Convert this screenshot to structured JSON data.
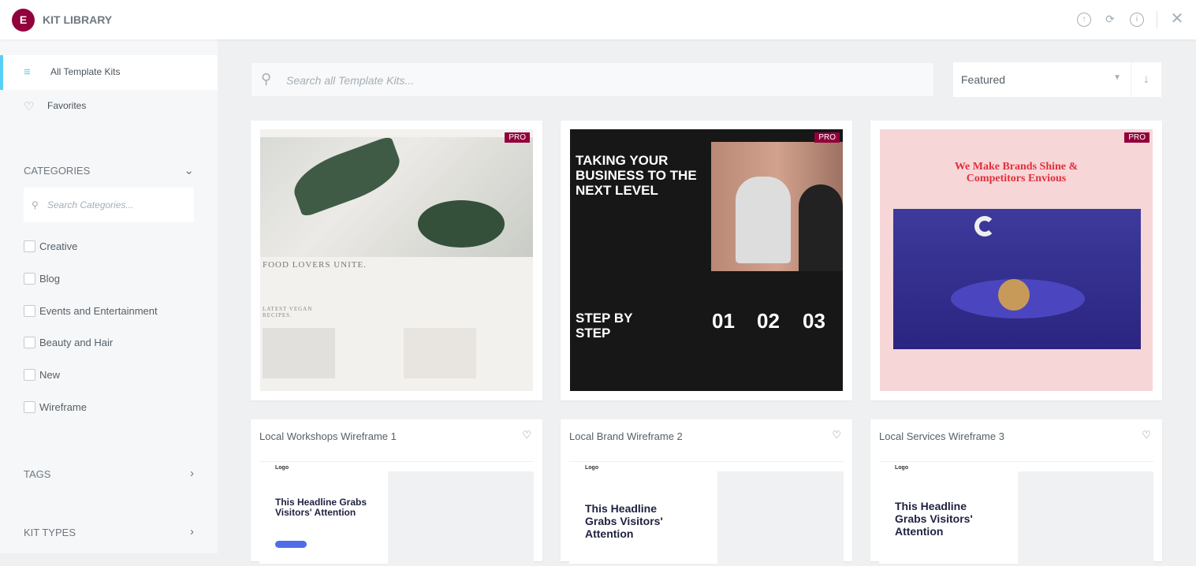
{
  "header": {
    "logo_letter": "E",
    "title": "KIT LIBRARY",
    "icons": [
      "upload-icon",
      "sync-icon",
      "info-icon",
      "close-icon"
    ]
  },
  "sidebar": {
    "nav": [
      {
        "label": "All Template Kits",
        "icon": "filter-icon",
        "active": true
      },
      {
        "label": "Favorites",
        "icon": "heart-icon"
      }
    ],
    "categories_label": "CATEGORIES",
    "categories_search_placeholder": "Search Categories...",
    "categories": [
      "Creative",
      "Blog",
      "Events and Entertainment",
      "Beauty and Hair",
      "New",
      "Wireframe"
    ],
    "tags_label": "TAGS",
    "kit_types_label": "KIT TYPES"
  },
  "main": {
    "search_placeholder": "Search all Template Kits...",
    "sort_value": "Featured",
    "pro_badge": "PRO",
    "kits": [
      {
        "thumb": {
          "headline": "FOOD LOVERS UNITE.",
          "sub": "LATEST VEGAN RECIPES."
        },
        "pro": true
      },
      {
        "thumb": {
          "headline": "TAKING YOUR BUSINESS TO THE NEXT LEVEL",
          "sub": "STEP BY STEP",
          "steps": [
            "01",
            "02",
            "03"
          ]
        },
        "pro": true
      },
      {
        "thumb": {
          "headline": "We Make Brands Shine & Competitors Envious"
        },
        "pro": true
      },
      {
        "title": "Local Workshops Wireframe 1",
        "thumb": {
          "logo": "Logo",
          "headline": "This Headline Grabs Visitors' Attention"
        }
      },
      {
        "title": "Local Brand Wireframe 2",
        "thumb": {
          "logo": "Logo",
          "headline": "This Headline Grabs Visitors' Attention"
        }
      },
      {
        "title": "Local Services Wireframe 3",
        "thumb": {
          "logo": "Logo",
          "headline": "This Headline Grabs Visitors' Attention"
        }
      }
    ]
  },
  "colors": {
    "brand": "#92003b",
    "accent": "#58d0f5"
  }
}
